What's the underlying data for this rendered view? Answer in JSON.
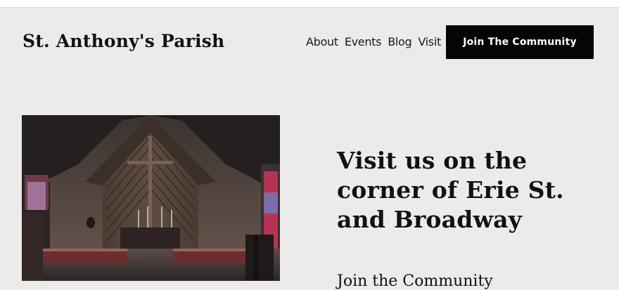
{
  "header": {
    "site_title": "St. Anthony's Parish",
    "nav": [
      "About",
      "Events",
      "Blog",
      "Visit"
    ],
    "cta_label": "Join The Community"
  },
  "hero": {
    "image_icon": "church-altar-photo",
    "heading": "Visit us on the corner of Erie St. and Broadway",
    "subheading": "Join the Community"
  },
  "colors": {
    "background": "#ecebe9",
    "cta_background": "#050505",
    "cta_text": "#ffffff",
    "text": "#111111"
  }
}
